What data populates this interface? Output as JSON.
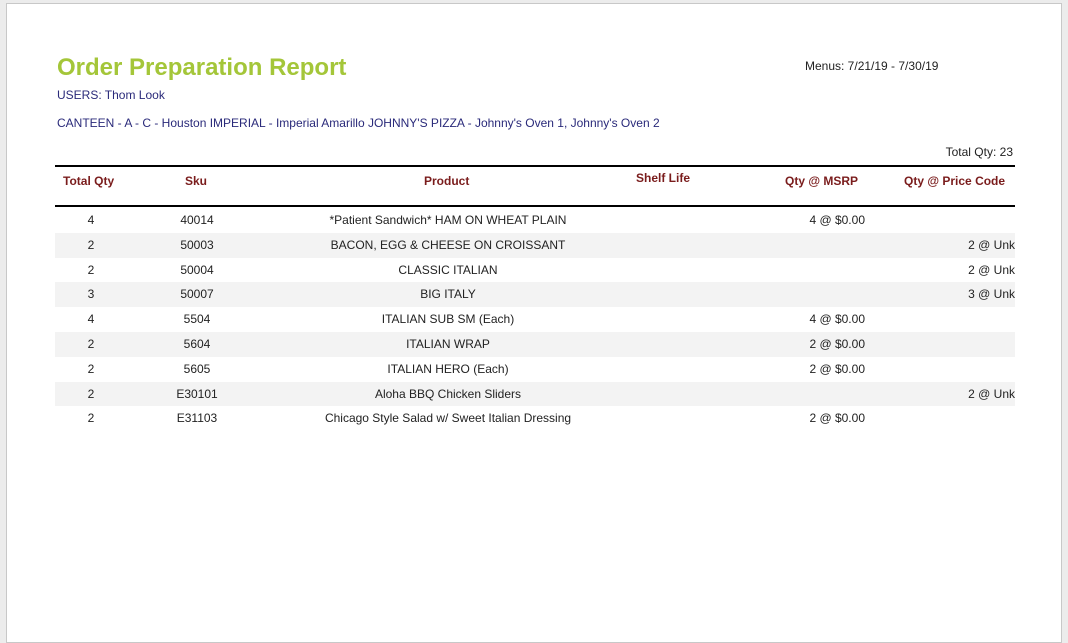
{
  "report": {
    "title": "Order Preparation Report",
    "users": "USERS: Thom Look",
    "menus": "Menus: 7/21/19  -  7/30/19",
    "locations": "CANTEEN - A - C - Houston  IMPERIAL - Imperial Amarillo  JOHNNY'S PIZZA - Johnny's Oven 1, Johnny's Oven 2",
    "total_qty": "Total Qty: 23"
  },
  "table": {
    "headers": {
      "total_qty": "Total Qty",
      "sku": "Sku",
      "product": "Product",
      "shelf_life": "Shelf Life",
      "qty_msrp": "Qty @ MSRP",
      "qty_price_code": "Qty @ Price Code"
    },
    "rows": [
      {
        "qty": "4",
        "sku": "40014",
        "product": "*Patient Sandwich* HAM ON WHEAT PLAIN",
        "msrp": "4 @ $0.00",
        "code": ""
      },
      {
        "qty": "2",
        "sku": "50003",
        "product": "BACON, EGG & CHEESE ON CROISSANT",
        "msrp": "",
        "code": "2 @ Unk"
      },
      {
        "qty": "2",
        "sku": "50004",
        "product": "CLASSIC ITALIAN",
        "msrp": "",
        "code": "2 @ Unk"
      },
      {
        "qty": "3",
        "sku": "50007",
        "product": "BIG ITALY",
        "msrp": "",
        "code": "3 @ Unk"
      },
      {
        "qty": "4",
        "sku": "5504",
        "product": "ITALIAN SUB SM (Each)",
        "msrp": "4 @ $0.00",
        "code": ""
      },
      {
        "qty": "2",
        "sku": "5604",
        "product": "ITALIAN WRAP",
        "msrp": "2 @ $0.00",
        "code": ""
      },
      {
        "qty": "2",
        "sku": "5605",
        "product": "ITALIAN HERO (Each)",
        "msrp": "2 @ $0.00",
        "code": ""
      },
      {
        "qty": "2",
        "sku": "E30101",
        "product": "Aloha BBQ Chicken Sliders",
        "msrp": "",
        "code": "2 @ Unk"
      },
      {
        "qty": "2",
        "sku": "E31103",
        "product": "Chicago Style Salad w/ Sweet Italian Dressing",
        "msrp": "2 @ $0.00",
        "code": ""
      }
    ]
  },
  "colors": {
    "title": "#a4c639",
    "header": "#7a1c1c",
    "link_text": "#2a2a7a",
    "stripe": "#f3f3f3"
  }
}
